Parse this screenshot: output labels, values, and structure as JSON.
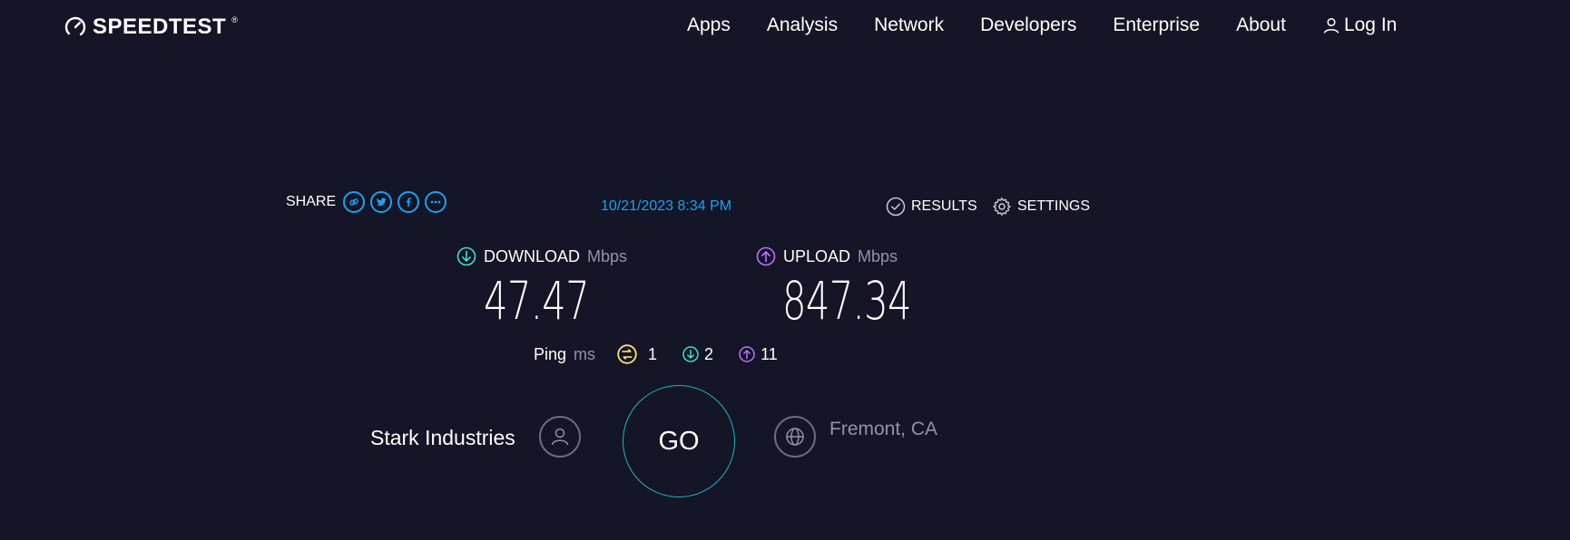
{
  "header": {
    "logo_text": "SPEEDTEST",
    "logo_tm": "®",
    "nav": [
      "Apps",
      "Analysis",
      "Network",
      "Developers",
      "Enterprise",
      "About"
    ],
    "login_label": "Log In"
  },
  "share": {
    "label": "SHARE",
    "icons": [
      "link-icon",
      "twitter-icon",
      "facebook-icon",
      "more-icon"
    ]
  },
  "result_datetime": "10/21/2023 8:34 PM",
  "actions": {
    "results_label": "RESULTS",
    "settings_label": "SETTINGS"
  },
  "download": {
    "label": "DOWNLOAD",
    "unit": "Mbps",
    "value": "47.47"
  },
  "upload": {
    "label": "UPLOAD",
    "unit": "Mbps",
    "value": "847.34"
  },
  "ping": {
    "label": "Ping",
    "unit": "ms",
    "idle": "1",
    "download": "2",
    "upload": "11"
  },
  "isp": {
    "name": "Stark Industries"
  },
  "go_label": "GO",
  "server": {
    "location": "Fremont, CA"
  },
  "colors": {
    "background": "#141526",
    "accent_blue": "#1da1f2",
    "download_cyan": "#3ee0d0",
    "upload_purple": "#bf71ff",
    "ping_yellow": "#f9e27a",
    "go_ring": "#1fb5c7"
  }
}
